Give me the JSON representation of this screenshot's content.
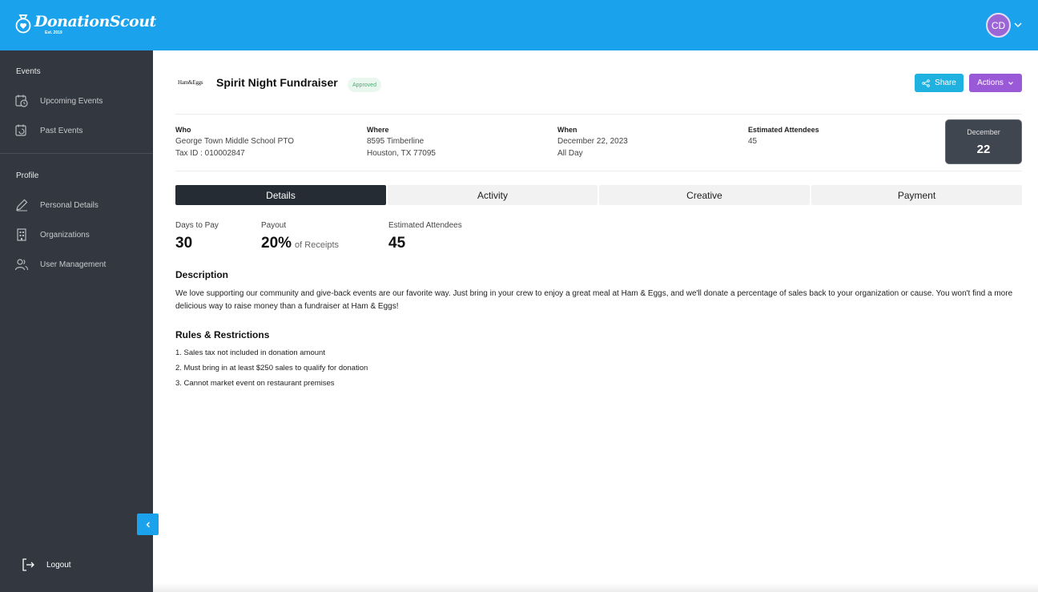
{
  "app": {
    "brand_name": "DonationScout",
    "brand_sub": "Est. 2019",
    "user_initials": "CD"
  },
  "sidebar": {
    "events_heading": "Events",
    "events_items": [
      {
        "label": "Upcoming Events",
        "icon": "calendar-clock-icon"
      },
      {
        "label": "Past Events",
        "icon": "calendar-history-icon"
      }
    ],
    "profile_heading": "Profile",
    "profile_items": [
      {
        "label": "Personal Details",
        "icon": "pencil-icon"
      },
      {
        "label": "Organizations",
        "icon": "building-icon"
      },
      {
        "label": "User Management",
        "icon": "users-icon"
      }
    ],
    "logout_label": "Logout"
  },
  "event": {
    "logo_text": "Ham&Eggs",
    "title": "Spirit Night Fundraiser",
    "status": "Approved",
    "share_label": "Share",
    "actions_label": "Actions",
    "who_label": "Who",
    "who_value": "George Town Middle School PTO",
    "tax_id": "Tax ID : 010002847",
    "where_label": "Where",
    "where_line1": "8595 Timberline",
    "where_line2": "Houston, TX 77095",
    "when_label": "When",
    "when_date": "December 22, 2023",
    "when_time": "All Day",
    "attendees_label": "Estimated Attendees",
    "attendees_value": "45",
    "date_month": "December",
    "date_day": "22"
  },
  "tabs": [
    "Details",
    "Activity",
    "Creative",
    "Payment"
  ],
  "active_tab": "Details",
  "stats": {
    "days_to_pay_label": "Days to Pay",
    "days_to_pay_value": "30",
    "payout_label": "Payout",
    "payout_value": "20%",
    "payout_suffix": "of Receipts",
    "attendees_label": "Estimated Attendees",
    "attendees_value": "45"
  },
  "description": {
    "title": "Description",
    "text": "We love supporting our community and give-back events are our favorite way. Just bring in your crew to enjoy a great meal at Ham & Eggs, and we'll donate a percentage of sales back to your organization or cause. You won't find a more delicious way to raise money than a fundraiser at Ham & Eggs!"
  },
  "rules": {
    "title": "Rules & Restrictions",
    "items": [
      "1. Sales tax not included in donation amount",
      "2. Must bring in at least $250 sales to qualify for donation",
      "3. Cannot market event on restaurant premises"
    ]
  },
  "colors": {
    "topbar": "#1aa3ec",
    "sidebar": "#333840",
    "share": "#1fb1e0",
    "actions": "#9a5ad7",
    "approved": "#3cb371"
  }
}
